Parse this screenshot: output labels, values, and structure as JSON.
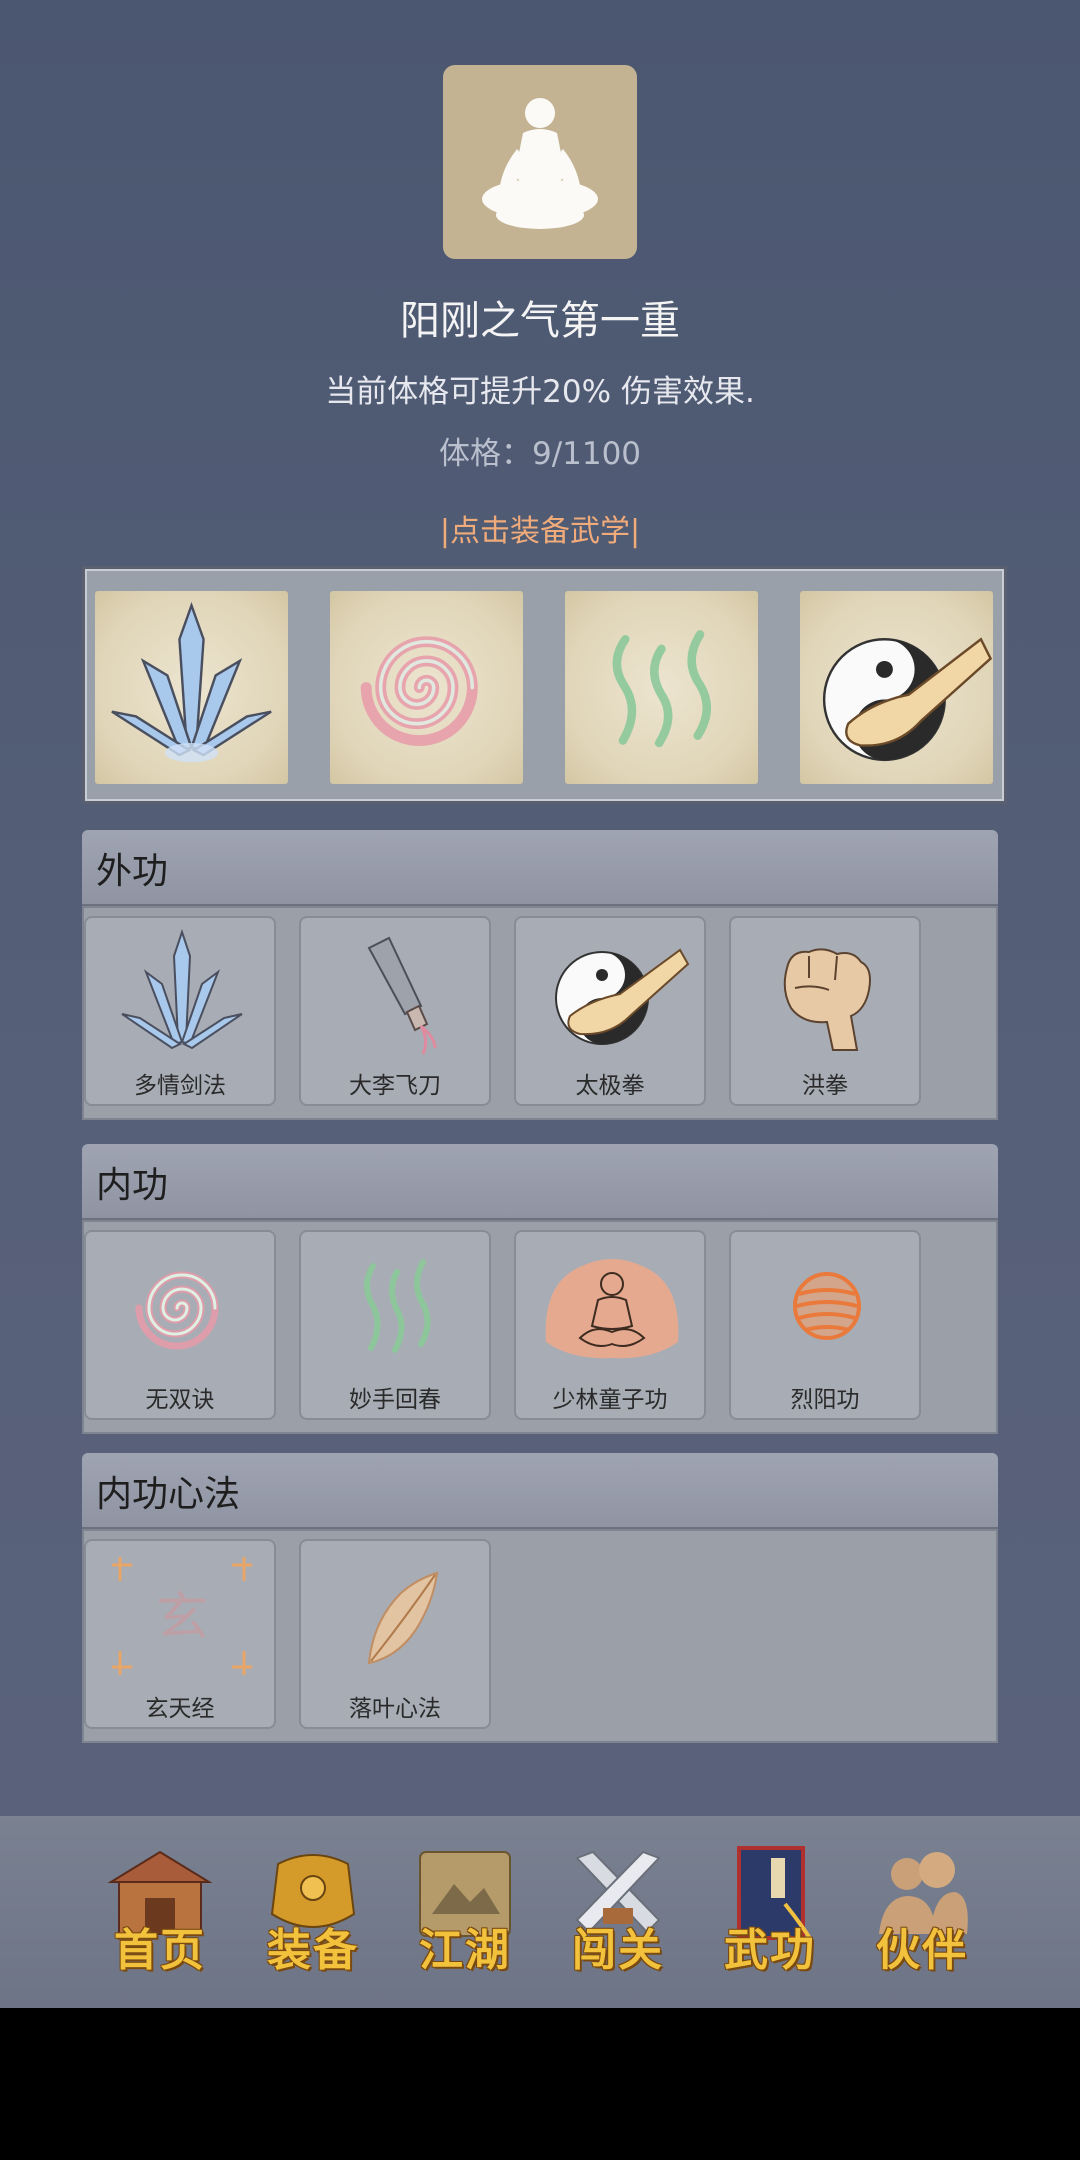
{
  "header": {
    "avatar_icon": "meditation-figure-icon",
    "title": "阳刚之气第一重",
    "description": "当前体格可提升20% 伤害效果.",
    "stat": "体格：9/1100",
    "equip_link": "|点击装备武学|"
  },
  "equipped_slots": [
    {
      "icon": "blue-crystal-blades-icon"
    },
    {
      "icon": "pink-swirl-icon"
    },
    {
      "icon": "green-waves-icon"
    },
    {
      "icon": "taiji-fist-icon"
    }
  ],
  "sections": [
    {
      "title": "外功",
      "skills": [
        {
          "label": "多情剑法",
          "icon": "blue-crystal-blades-icon"
        },
        {
          "label": "大李飞刀",
          "icon": "flying-knife-icon"
        },
        {
          "label": "太极拳",
          "icon": "taiji-fist-icon"
        },
        {
          "label": "洪拳",
          "icon": "fist-icon"
        }
      ]
    },
    {
      "title": "内功",
      "skills": [
        {
          "label": "无双诀",
          "icon": "pink-swirl-icon"
        },
        {
          "label": "妙手回春",
          "icon": "green-waves-icon"
        },
        {
          "label": "少林童子功",
          "icon": "monk-icon"
        },
        {
          "label": "烈阳功",
          "icon": "fire-orb-icon"
        }
      ]
    },
    {
      "title": "内功心法",
      "skills": [
        {
          "label": "玄天经",
          "icon": "xuan-scroll-icon",
          "glyph": "玄"
        },
        {
          "label": "落叶心法",
          "icon": "falling-leaf-icon"
        }
      ]
    }
  ],
  "nav": [
    {
      "label": "首页",
      "icon": "house-icon"
    },
    {
      "label": "装备",
      "icon": "armor-icon"
    },
    {
      "label": "江湖",
      "icon": "scroll-map-icon"
    },
    {
      "label": "闯关",
      "icon": "crossed-swords-icon"
    },
    {
      "label": "武功",
      "icon": "martial-book-icon"
    },
    {
      "label": "伙伴",
      "icon": "partners-icon"
    }
  ],
  "colors": {
    "background": "#4f5a73",
    "panel": "#9a9fa8",
    "link": "#f0ab7a",
    "nav_label": "#f3c23c"
  }
}
